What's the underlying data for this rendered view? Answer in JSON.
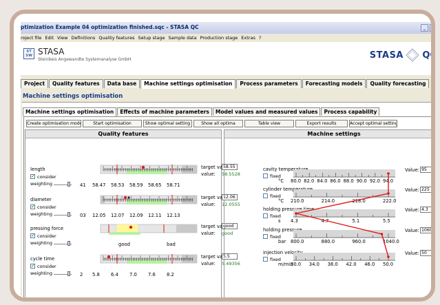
{
  "window": {
    "title": "ptimization Example 04 optimization finished.sqc   -   STASA QC"
  },
  "menu": [
    "roject file",
    "Edit",
    "View",
    "Definitions",
    "Quality features",
    "Setup stage",
    "Sample data",
    "Production stage",
    "Extras",
    "?"
  ],
  "brand": {
    "logo_text": "ST\nSW",
    "name": "STASA",
    "subtitle": "Steinbeis Angewandte Systemanalyse GmbH",
    "right_name": "STASA",
    "right_suffix": "QC"
  },
  "main_tabs": [
    "Project",
    "Quality features",
    "Data base",
    "Machine settings optimisation",
    "Process parameters",
    "Forecasting models",
    "Quality forecasting"
  ],
  "main_tab_active": "Machine settings optimisation",
  "section_title": "Machine settings optimisation",
  "sub_tabs": [
    "Machine settings optimisation",
    "Effects of machine parameters",
    "Model values and measured values",
    "Process capability"
  ],
  "sub_tab_active": "Machine settings optimisation",
  "buttons": [
    "Create optimisation models",
    "Start optimisation",
    "Show optimal setting",
    "Show all optima",
    "Table view",
    "Export results",
    "Accept optimal setting"
  ],
  "quality_pane": {
    "title": "Quality features",
    "consider_label": "consider",
    "weighting_label": "weighting",
    "target_label": "target valu",
    "value_label": "value:",
    "features": [
      {
        "name": "length",
        "consider": true,
        "target": "58.55",
        "value": "58.5528",
        "weight": "41",
        "ticks": [
          "58.47",
          "58.53",
          "58.59",
          "58.65",
          "58.71"
        ],
        "slider": 0.85
      },
      {
        "name": "diameter",
        "consider": true,
        "target": "12.06",
        "value": "12.0555",
        "weight": "03",
        "ticks": [
          "12.05",
          "12.07",
          "12.09",
          "12.11",
          "12.13"
        ],
        "slider": 0.85
      },
      {
        "name": "pressing force",
        "consider": true,
        "target": "good",
        "value": "good",
        "weight": "",
        "ticks": [
          "good",
          "bad"
        ],
        "slider": 0.85
      },
      {
        "name": "cycle time",
        "consider": true,
        "target": "5.5",
        "value": "5.49356",
        "weight": "2",
        "ticks": [
          "5.8",
          "6.4",
          "7.0",
          "7.6",
          "8.2"
        ],
        "slider": 0.85
      }
    ]
  },
  "machine_pane": {
    "title": "Machine settings",
    "fixed_label": "fixed",
    "value_label": "Value:",
    "settings": [
      {
        "name": "cavity temperature",
        "unit": "°C",
        "value": "95",
        "ticks": [
          "80.0",
          "82.0",
          "84.0",
          "86.0",
          "88.0",
          "90.0",
          "92.0",
          "94.0"
        ],
        "fixed": false,
        "setting": 94.5,
        "min": 80,
        "max": 94
      },
      {
        "name": "cylinder temperature",
        "unit": "°C",
        "value": "225",
        "ticks": [
          "210.0",
          "214.0",
          "218.0",
          "222.0"
        ],
        "fixed": false,
        "setting": 225,
        "min": 210,
        "max": 224
      },
      {
        "name": "holding pressure time",
        "unit": "s",
        "value": "4.3",
        "ticks": [
          "4.3",
          "4.7",
          "5.1",
          "5.5"
        ],
        "fixed": false,
        "setting": 4.3,
        "min": 4.3,
        "max": 5.7
      },
      {
        "name": "holding pressure",
        "unit": "bar",
        "value": "1060",
        "ticks": [
          "800.0",
          "880.0",
          "960.0",
          "1040.0"
        ],
        "fixed": false,
        "setting": 1060,
        "min": 800,
        "max": 1080
      },
      {
        "name": "injection velocity",
        "unit": "m/min",
        "value": "50",
        "ticks": [
          "30.0",
          "34.0",
          "38.0",
          "42.0",
          "46.0",
          "50.0"
        ],
        "fixed": false,
        "setting": 50,
        "min": 30,
        "max": 50
      }
    ]
  },
  "colors": {
    "accent": "#1b3b87",
    "green_zone": "#b8f0a4",
    "yellow_zone": "#fff79a",
    "grey_zone": "#c8c8c8",
    "marker": "#e01818",
    "value_green": "#1a7a1a"
  }
}
